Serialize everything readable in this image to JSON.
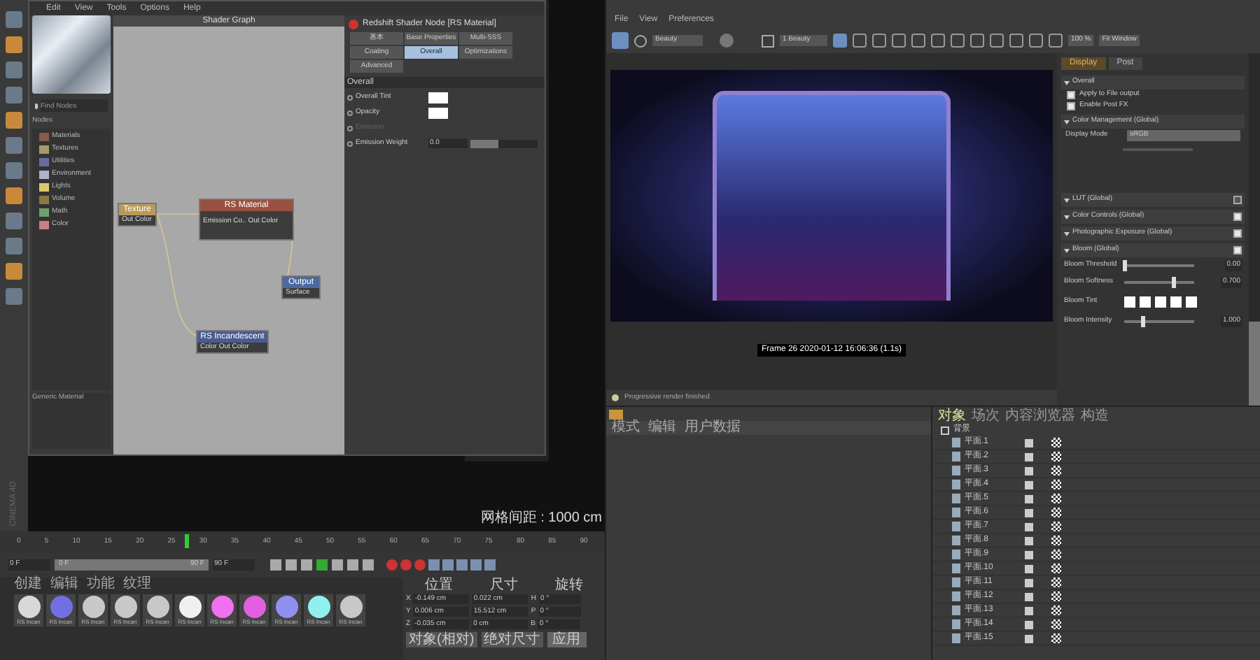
{
  "app_menu": [
    "Edit",
    "View",
    "Tools",
    "Options",
    "Help"
  ],
  "shader_graph": {
    "title": "Shader Graph",
    "search_placeholder": "Find Nodes",
    "nodes_header": "Nodes",
    "categories": [
      {
        "label": "Materials",
        "color": "#8a5a4a"
      },
      {
        "label": "Textures",
        "color": "#a8986a"
      },
      {
        "label": "Utilities",
        "color": "#6a6aa0"
      },
      {
        "label": "Environment",
        "color": "#b0b0c8"
      },
      {
        "label": "Lights",
        "color": "#d8c870"
      },
      {
        "label": "Volume",
        "color": "#8a7a40"
      },
      {
        "label": "Math",
        "color": "#70a070"
      },
      {
        "label": "Color",
        "color": "#c88080"
      }
    ],
    "description": "Generic Material",
    "graph_nodes": [
      {
        "kind": "texture",
        "title": "Texture",
        "port": "Out Color"
      },
      {
        "kind": "material",
        "title": "RS Material",
        "port": "Emission Co.. Out Color"
      },
      {
        "kind": "output",
        "title": "Output",
        "port": "Surface"
      },
      {
        "kind": "incandescent",
        "title": "RS Incandescent",
        "port": "Color Out Color"
      }
    ],
    "properties": {
      "title": "Redshift Shader Node [RS Material]",
      "tabs": [
        {
          "label": "基本",
          "selected": false
        },
        {
          "label": "Base Properties",
          "selected": false
        },
        {
          "label": "Multi-SSS",
          "selected": false
        },
        {
          "label": "Coating",
          "selected": false
        },
        {
          "label": "Overall",
          "selected": true
        },
        {
          "label": "Optimizations",
          "selected": false
        },
        {
          "label": "Advanced",
          "selected": false
        }
      ],
      "section": "Overall",
      "params": [
        {
          "kind": "swatch",
          "label": "Overall Tint",
          "disabled": false
        },
        {
          "kind": "swatch",
          "label": "Opacity",
          "disabled": false
        },
        {
          "kind": "plain",
          "label": "Emission",
          "disabled": true
        },
        {
          "kind": "slider",
          "label": "Emission Weight",
          "value": "0.0",
          "level": 0,
          "disabled": false
        }
      ]
    }
  },
  "viewport": {
    "grid_label": "网格间距 : 1000 cm"
  },
  "timeline": {
    "ticks": [
      "0",
      "5",
      "10",
      "15",
      "20",
      "25",
      "30",
      "35",
      "40",
      "45",
      "50",
      "55",
      "60",
      "65",
      "70",
      "75",
      "80",
      "85",
      "90"
    ],
    "level": 0.3,
    "start": "0 F",
    "range_start": "0 F",
    "range_end": "90 F",
    "end": "90 F"
  },
  "materials": {
    "menu": [
      "创建",
      "编辑",
      "功能",
      "纹理"
    ],
    "swatches": [
      {
        "label": "RS Incan",
        "color": "#d8d8d8"
      },
      {
        "label": "RS Incan",
        "color": "#7070e0"
      },
      {
        "label": "RS Incan",
        "color": "#c8c8c8"
      },
      {
        "label": "RS Incan",
        "color": "#c8c8c8"
      },
      {
        "label": "RS Incan",
        "color": "#c8c8c8"
      },
      {
        "label": "RS Incan",
        "color": "#f0f0f0"
      },
      {
        "label": "RS Incan",
        "color": "#f070f0"
      },
      {
        "label": "RS Incan",
        "color": "#e060e0"
      },
      {
        "label": "RS Incan",
        "color": "#9090f0"
      },
      {
        "label": "RS Incan",
        "color": "#90f0f0"
      },
      {
        "label": "RS Incan",
        "color": "#c8c8c8"
      }
    ]
  },
  "coordinates": {
    "headers": [
      "位置",
      "尺寸",
      "旋转"
    ],
    "rows": [
      {
        "axis": "X",
        "position": "-0.149 cm",
        "size": "0.022 cm",
        "rot_axis": "H",
        "rotation": "0 °"
      },
      {
        "axis": "Y",
        "position": "0.006 cm",
        "size": "15.512 cm",
        "rot_axis": "P",
        "rotation": "0 °"
      },
      {
        "axis": "Z",
        "position": "-0.035 cm",
        "size": "0 cm",
        "rot_axis": "B",
        "rotation": "0 °"
      }
    ],
    "mode": "对象(相对)",
    "size_mode": "绝对尺寸",
    "apply": "应用"
  },
  "render_view": {
    "menu": [
      "File",
      "View",
      "Preferences"
    ],
    "aov": "Beauty",
    "camera": "1 Beauty",
    "zoom": "100 %",
    "fit": "Fit Window",
    "caption": "Frame 26  2020-01-12  16:06:36  (1.1s)",
    "status": "Progressive render finished",
    "settings": {
      "tabs": [
        {
          "label": "Display",
          "selected": true
        },
        {
          "label": "Post",
          "selected": false
        }
      ],
      "sections": [
        {
          "kind": "group",
          "title": "Overall",
          "checks": [
            {
              "label": "Apply to File output",
              "checked": true
            },
            {
              "label": "Enable Post FX",
              "checked": true
            }
          ]
        },
        {
          "kind": "color",
          "title": "Color Management (Global)",
          "mode_label": "Display Mode",
          "mode": "sRGB"
        },
        {
          "kind": "toggle",
          "title": "LUT (Global)",
          "checked": false
        },
        {
          "kind": "toggle",
          "title": "Color Controls (Global)",
          "checked": true
        },
        {
          "kind": "toggle",
          "title": "Photographic Exposure (Global)",
          "checked": true
        },
        {
          "kind": "bloom",
          "title": "Bloom (Global)",
          "checked": true,
          "sliders": [
            {
              "label": "Bloom Threshold",
              "value": "0.00",
              "level": 0
            },
            {
              "label": "Bloom Softness",
              "value": "0.700",
              "level": 0.7
            }
          ],
          "tint_label": "Bloom Tint",
          "intensity": {
            "label": "Bloom Intensity",
            "value": "1.000",
            "level": 0.25
          }
        }
      ]
    }
  },
  "object_manager": {
    "left_tabs": [
      "模式",
      "编辑",
      "用户数据"
    ],
    "tabs": [
      {
        "label": "对象",
        "selected": true
      },
      {
        "label": "场次",
        "selected": false
      },
      {
        "label": "内容浏览器",
        "selected": false
      },
      {
        "label": "构造",
        "selected": false
      }
    ],
    "root": "背景",
    "rows": [
      "平面.1",
      "平面.2",
      "平面.3",
      "平面.4",
      "平面.5",
      "平面.6",
      "平面.7",
      "平面.8",
      "平面.9",
      "平面.10",
      "平面.11",
      "平面.12",
      "平面.13",
      "平面.14",
      "平面.15"
    ]
  },
  "side_label": "CINEMA 4D"
}
